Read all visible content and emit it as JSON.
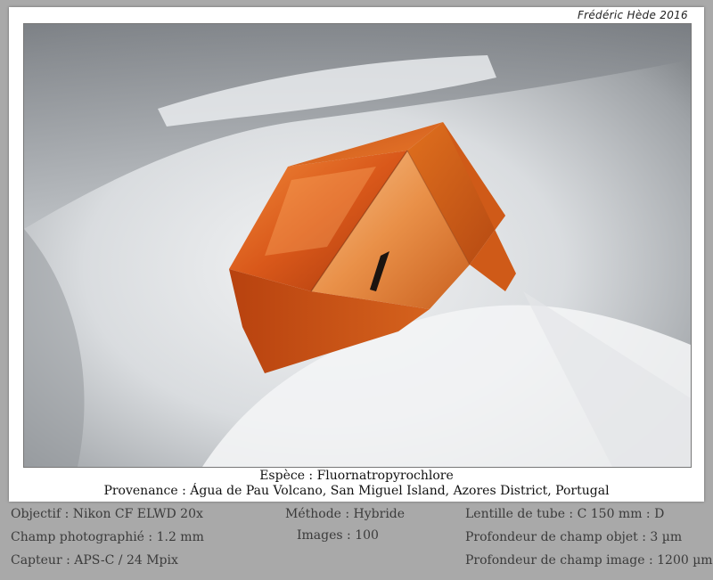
{
  "credit": "Frédéric Hède 2016",
  "species_line": "Espèce : Fluornatropyrochlore",
  "provenance_line": "Provenance : Água de Pau Volcano, San Miguel Island, Azores District, Portugal",
  "specs": {
    "left": [
      "Objectif : Nikon CF ELWD 20x",
      "Champ photographié : 1.2 mm",
      "Capteur : APS-C / 24 Mpix"
    ],
    "middle": [
      "Méthode : Hybride",
      "Images : 100"
    ],
    "right": [
      "Lentille de tube : C 150 mm : D",
      "Profondeur de champ objet : 3 µm",
      "Profondeur de champ image : 1200 µm"
    ]
  },
  "colors": {
    "crystal_main": "#e0661c",
    "crystal_dark": "#a8380c",
    "crystal_light": "#f4a35a",
    "matrix": "#d4d7da",
    "background_gray": "#a9a9a9"
  }
}
